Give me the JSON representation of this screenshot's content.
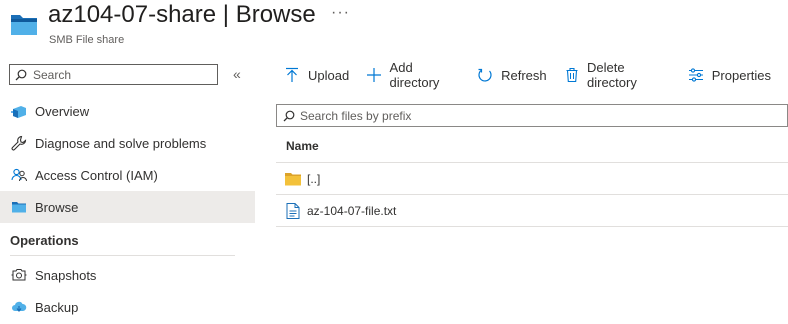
{
  "header": {
    "title_name": "az104-07-share",
    "title_separator": "|",
    "title_page": "Browse",
    "more_label": "···",
    "subtitle": "SMB File share"
  },
  "sidebar": {
    "search_placeholder": "Search",
    "collapse_label": "«",
    "items": [
      {
        "label": "Overview",
        "icon": "overview-icon"
      },
      {
        "label": "Diagnose and solve problems",
        "icon": "wrench-icon"
      },
      {
        "label": "Access Control (IAM)",
        "icon": "people-icon"
      },
      {
        "label": "Browse",
        "icon": "folder-icon",
        "active": true
      }
    ],
    "sections": [
      {
        "title": "Operations",
        "items": [
          {
            "label": "Snapshots",
            "icon": "snapshot-icon"
          },
          {
            "label": "Backup",
            "icon": "backup-icon"
          }
        ]
      }
    ]
  },
  "toolbar": {
    "upload": "Upload",
    "add_directory": "Add directory",
    "refresh": "Refresh",
    "delete_directory": "Delete directory",
    "properties": "Properties"
  },
  "filter": {
    "placeholder": "Search files by prefix"
  },
  "grid": {
    "column_name": "Name",
    "rows": [
      {
        "name": "[..]",
        "type": "folder"
      },
      {
        "name": "az-104-07-file.txt",
        "type": "file"
      }
    ]
  },
  "colors": {
    "accent": "#0078d4",
    "folder_yellow": "#f3c13a",
    "active_bg": "#edebe9"
  }
}
